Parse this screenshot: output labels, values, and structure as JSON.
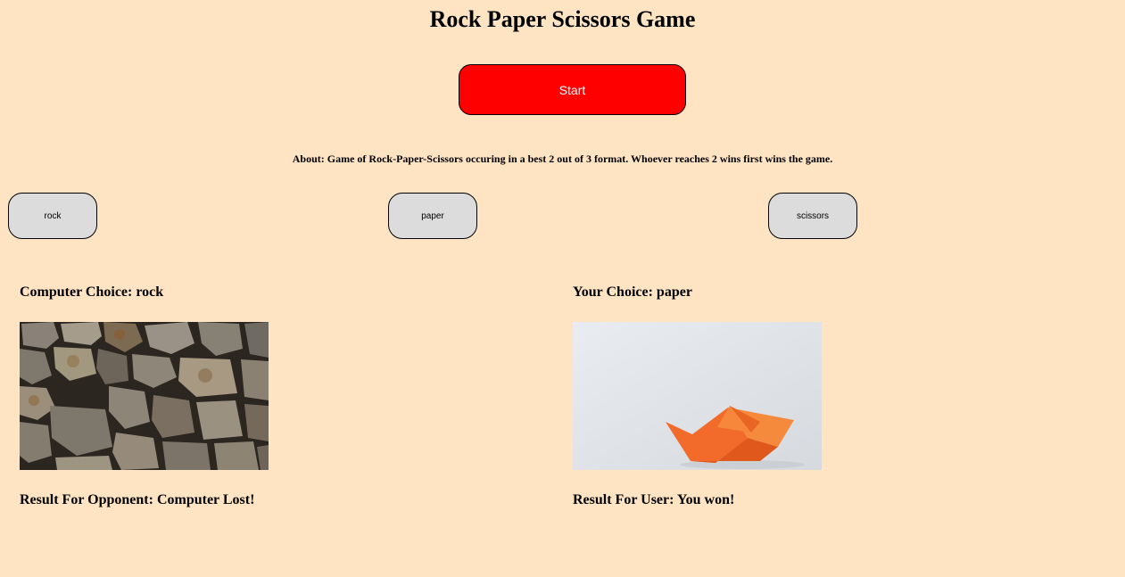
{
  "page": {
    "title": "Rock Paper Scissors Game",
    "about": "About: Game of Rock-Paper-Scissors occuring in a best 2 out of 3 format. Whoever reaches 2 wins first wins the game."
  },
  "controls": {
    "start_label": "Start",
    "choices": [
      {
        "label": "rock"
      },
      {
        "label": "paper"
      },
      {
        "label": "scissors"
      }
    ]
  },
  "computer": {
    "choice_text": "Computer Choice: rock",
    "result_text": "Result For Opponent: Computer Lost!",
    "image": "rock-wall-photo"
  },
  "user": {
    "choice_text": "Your Choice: paper",
    "result_text": "Result For User: You won!",
    "image": "paper-boat-photo"
  },
  "colors": {
    "background": "#ffe4c4",
    "start_button": "#ff0000",
    "choice_button": "#dcdcdc"
  }
}
